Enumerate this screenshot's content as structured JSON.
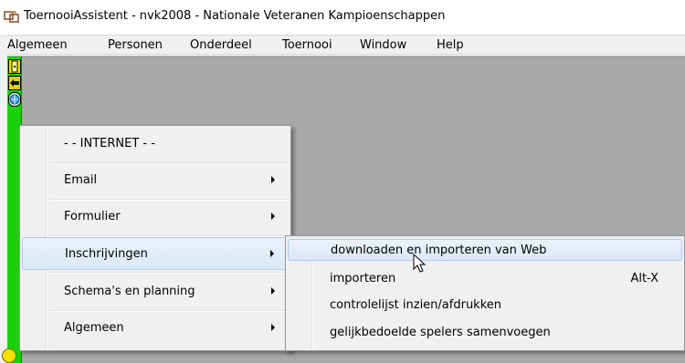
{
  "window": {
    "title": "ToernooiAssistent - nvk2008 - Nationale  Veteranen Kampioenschappen"
  },
  "menubar": {
    "items": [
      "Algemeen",
      "Personen",
      "Onderdeel",
      "Toernooi",
      "Window",
      "Help"
    ]
  },
  "context_menu": {
    "header": "- -  INTERNET  - -",
    "items": [
      {
        "label": "Email",
        "has_submenu": true
      },
      {
        "label": "Formulier",
        "has_submenu": true
      },
      {
        "label": "Inschrijvingen",
        "has_submenu": true,
        "highlighted": true
      },
      {
        "label": "Schema's en planning",
        "has_submenu": true
      },
      {
        "label": "Algemeen",
        "has_submenu": true
      }
    ]
  },
  "submenu": {
    "items": [
      {
        "label": "downloaden en importeren van Web",
        "shortcut": "",
        "highlighted": true
      },
      {
        "label": "importeren",
        "shortcut": "Alt-X"
      },
      {
        "label": "controlelijst inzien/afdrukken",
        "shortcut": ""
      },
      {
        "label": "gelijkbedoelde spelers samenvoegen",
        "shortcut": ""
      }
    ]
  },
  "colors": {
    "toolbar": "#18d10b",
    "workspace": "#a9a9a9",
    "menu_bg": "#f0f0f0",
    "highlight_border": "#aecbf0"
  },
  "icons": [
    "app-icon",
    "door-exit-icon",
    "arrows-icon",
    "globe-icon",
    "chevron-right-icon",
    "mouse-cursor-icon"
  ]
}
